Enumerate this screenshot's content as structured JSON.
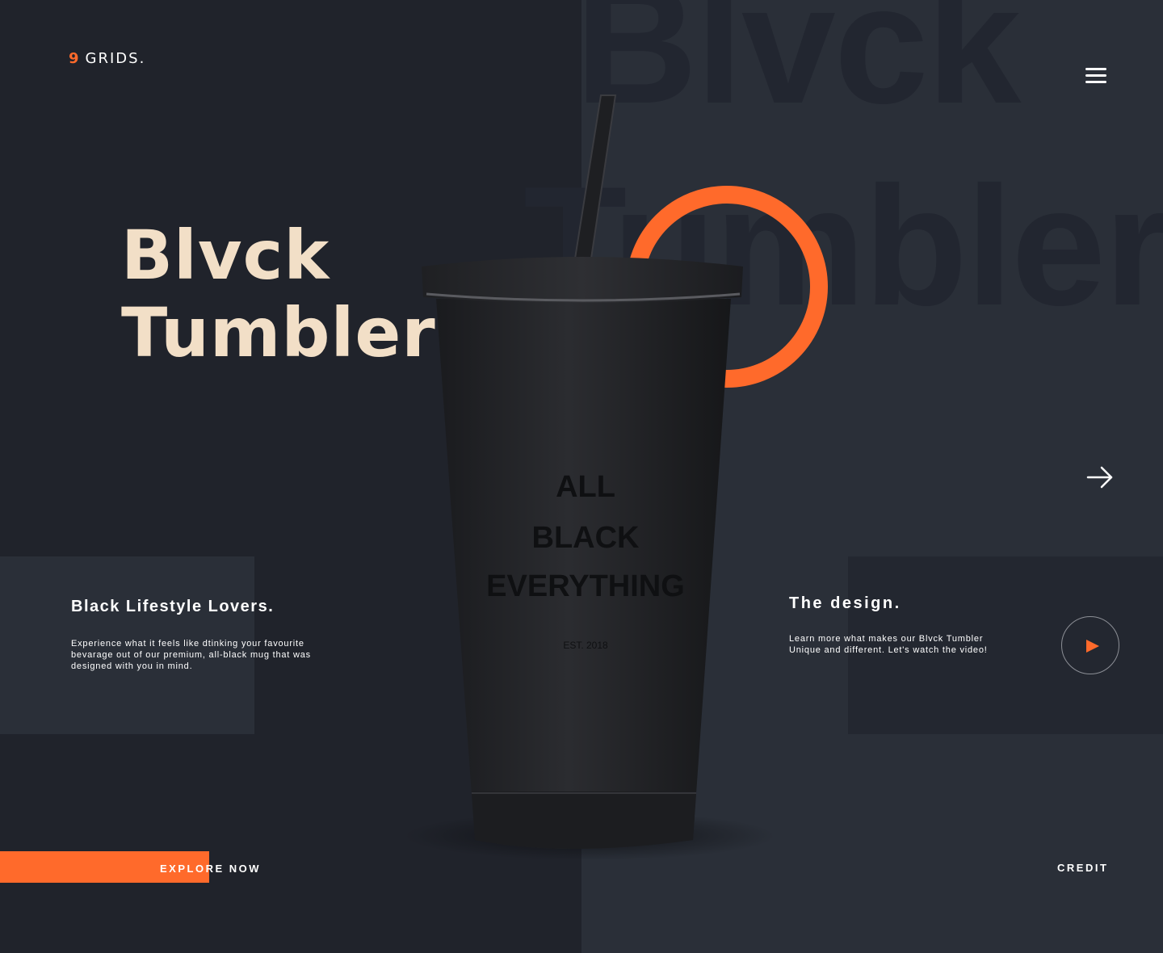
{
  "brand": {
    "number": "9",
    "name": "GRIDS."
  },
  "background_words": {
    "line1": "Blvck",
    "line2": "Tumbler"
  },
  "hero": {
    "title_line1": "Blvck",
    "title_line2": "Tumbler"
  },
  "product": {
    "print_line1": "ALL",
    "print_line2": "BLACK",
    "print_line3": "EVERYTHING",
    "print_est": "EST. 2018"
  },
  "left_card": {
    "heading": "Black Lifestyle Lovers.",
    "body": "Experience what it feels like dtinking your favourite bevarage out of our premium, all-black mug that was designed with you in mind."
  },
  "right_card": {
    "heading": "The design.",
    "body": "Learn more what makes our Blvck Tumbler Unique and different. Let's watch the video!"
  },
  "actions": {
    "explore": "EXPLORE NOW",
    "credit": "CREDIT"
  },
  "icons": {
    "menu": "hamburger-menu-icon",
    "next": "arrow-right-icon",
    "play": "play-icon"
  },
  "colors": {
    "accent": "#ff6a2b",
    "title": "#f2dfc7",
    "bg_dark": "#20232b",
    "bg_panel": "#2a2f38"
  }
}
